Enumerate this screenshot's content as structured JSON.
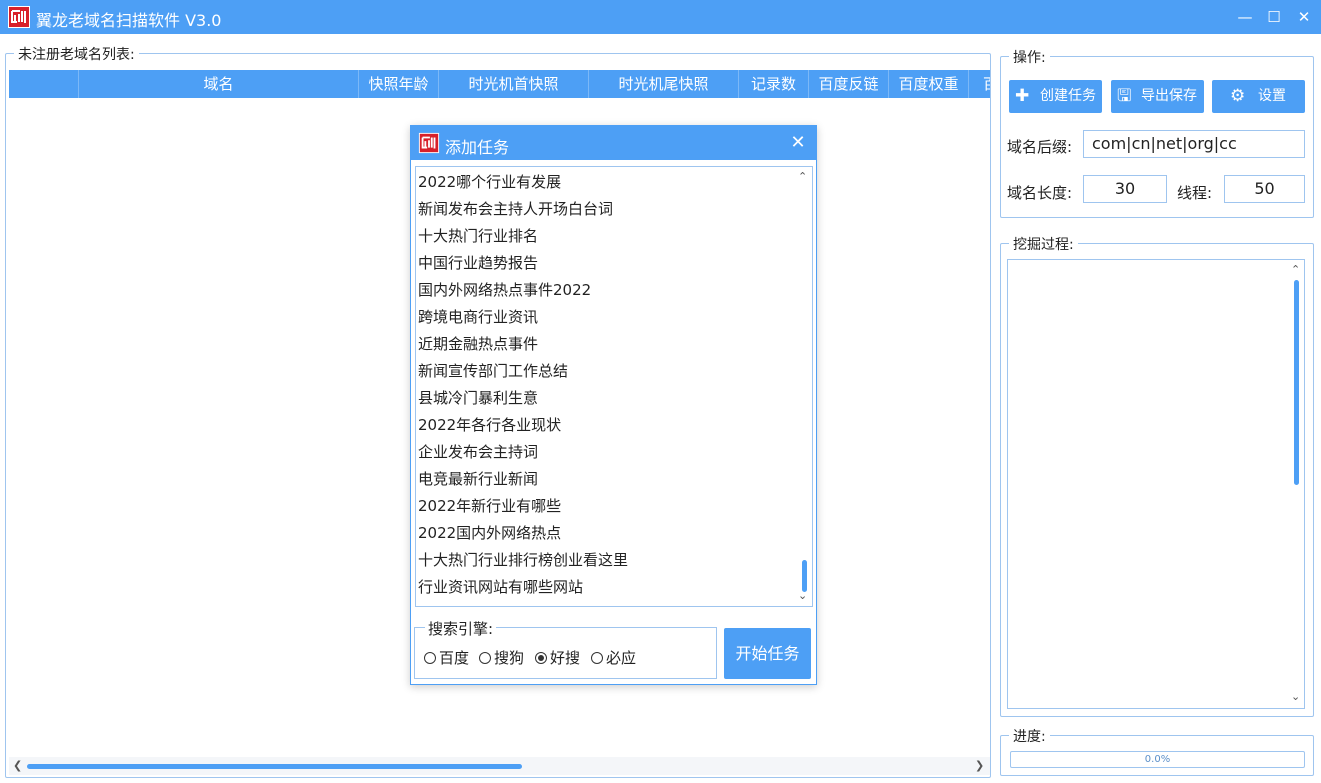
{
  "window": {
    "title": "翼龙老域名扫描软件 V3.0",
    "minimize": "—",
    "maximize": "☐",
    "close": "✕"
  },
  "left_panel": {
    "legend": "未注册老域名列表:",
    "columns": [
      "",
      "域名",
      "快照年龄",
      "时光机首快照",
      "时光机尾快照",
      "记录数",
      "百度反链",
      "百度权重",
      "百"
    ]
  },
  "dialog": {
    "title": "添加任务",
    "close": "✕",
    "keywords": [
      "2022哪个行业有发展",
      "新闻发布会主持人开场白台词",
      "十大热门行业排名",
      "中国行业趋势报告",
      "国内外网络热点事件2022",
      "跨境电商行业资讯",
      "近期金融热点事件",
      "新闻宣传部门工作总结",
      "县城冷门暴利生意",
      "2022年各行各业现状",
      "企业发布会主持词",
      "电竞最新行业新闻",
      "2022年新行业有哪些",
      "2022国内外网络热点",
      "十大热门行业排行榜创业看这里",
      "行业资讯网站有哪些网站"
    ],
    "engine_legend": "搜索引擎:",
    "engines": [
      {
        "label": "百度",
        "checked": false
      },
      {
        "label": "搜狗",
        "checked": false
      },
      {
        "label": "好搜",
        "checked": true
      },
      {
        "label": "必应",
        "checked": false
      }
    ],
    "start_button": "开始任务"
  },
  "operations": {
    "legend": "操作:",
    "create_button": "创建任务",
    "export_button": "导出保存",
    "settings_button": "设置",
    "suffix_label": "域名后缀:",
    "suffix_value": "com|cn|net|org|cc",
    "length_label": "域名长度:",
    "length_value": "30",
    "threads_label": "线程:",
    "threads_value": "50"
  },
  "mining": {
    "legend": "挖掘过程:"
  },
  "progress": {
    "legend": "进度:",
    "text": "0.0%",
    "value": 0
  },
  "colors": {
    "accent": "#4d9ff5",
    "border": "#9fc5ef"
  }
}
